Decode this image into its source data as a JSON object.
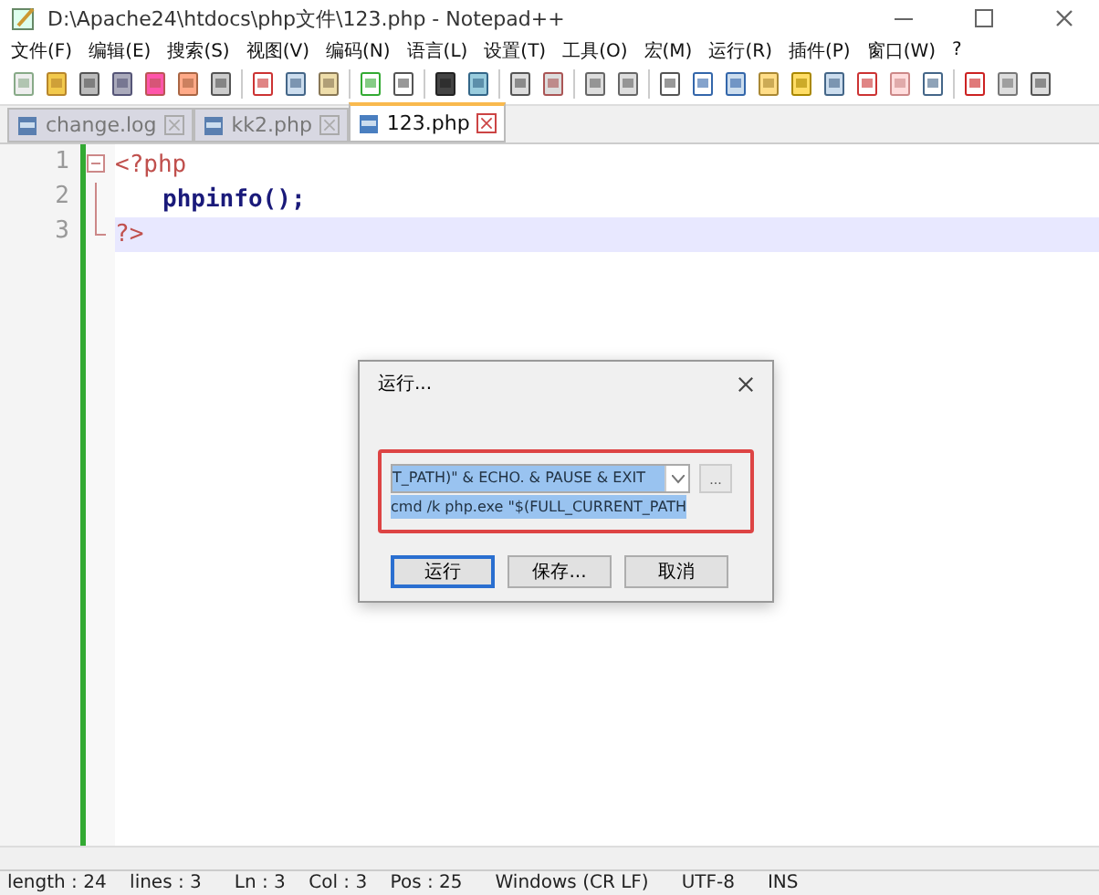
{
  "window": {
    "title": "D:\\Apache24\\htdocs\\php文件\\123.php - Notepad++"
  },
  "menu": [
    "文件(F)",
    "编辑(E)",
    "搜索(S)",
    "视图(V)",
    "编码(N)",
    "语言(L)",
    "设置(T)",
    "工具(O)",
    "宏(M)",
    "运行(R)",
    "插件(P)",
    "窗口(W)",
    "?"
  ],
  "tabs": [
    {
      "label": "change.log",
      "selected": false
    },
    {
      "label": "kk2.php",
      "selected": false
    },
    {
      "label": "123.php",
      "selected": true
    }
  ],
  "editor": {
    "lines": [
      {
        "number": "1",
        "code": "<?php",
        "kind": "open",
        "current": false
      },
      {
        "number": "2",
        "code": "phpinfo();",
        "kind": "body",
        "current": false
      },
      {
        "number": "3",
        "code": "?>",
        "kind": "close",
        "current": true
      }
    ]
  },
  "dialog": {
    "title": "运行...",
    "command": "T_PATH)\" & ECHO. & PAUSE & EXIT",
    "dropdown_item": "cmd /k php.exe \"$(FULL_CURRENT_PATH",
    "browse": "...",
    "buttons": [
      {
        "label": "运行",
        "selected": true
      },
      {
        "label": "保存...",
        "selected": false
      },
      {
        "label": "取消",
        "selected": false
      }
    ]
  },
  "status_bar": [
    "length : 24    lines : 3",
    "Ln : 3    Col : 3    Pos : 25",
    "Windows (CR LF)",
    "UTF-8",
    "INS"
  ]
}
